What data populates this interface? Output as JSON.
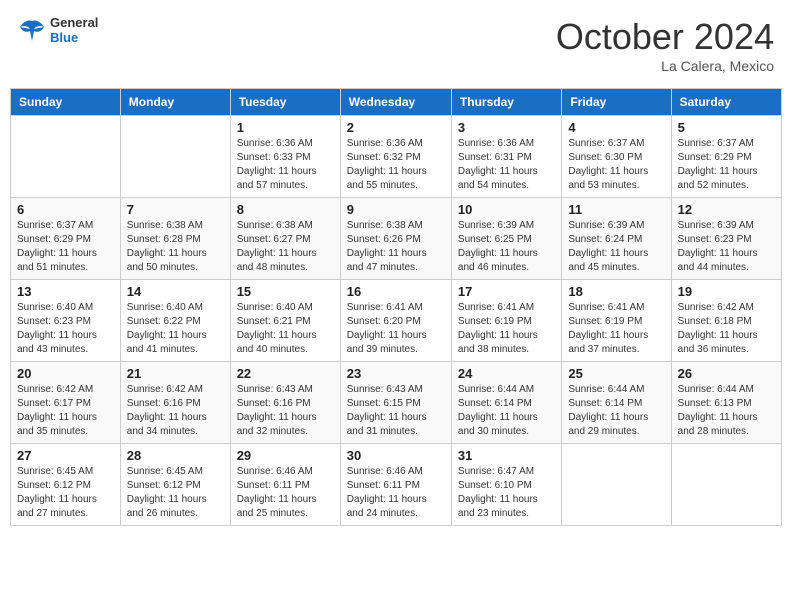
{
  "header": {
    "logo_line1": "General",
    "logo_line2": "Blue",
    "month_title": "October 2024",
    "subtitle": "La Calera, Mexico"
  },
  "weekdays": [
    "Sunday",
    "Monday",
    "Tuesday",
    "Wednesday",
    "Thursday",
    "Friday",
    "Saturday"
  ],
  "weeks": [
    [
      {
        "day": "",
        "info": ""
      },
      {
        "day": "",
        "info": ""
      },
      {
        "day": "1",
        "info": "Sunrise: 6:36 AM\nSunset: 6:33 PM\nDaylight: 11 hours and 57 minutes."
      },
      {
        "day": "2",
        "info": "Sunrise: 6:36 AM\nSunset: 6:32 PM\nDaylight: 11 hours and 55 minutes."
      },
      {
        "day": "3",
        "info": "Sunrise: 6:36 AM\nSunset: 6:31 PM\nDaylight: 11 hours and 54 minutes."
      },
      {
        "day": "4",
        "info": "Sunrise: 6:37 AM\nSunset: 6:30 PM\nDaylight: 11 hours and 53 minutes."
      },
      {
        "day": "5",
        "info": "Sunrise: 6:37 AM\nSunset: 6:29 PM\nDaylight: 11 hours and 52 minutes."
      }
    ],
    [
      {
        "day": "6",
        "info": "Sunrise: 6:37 AM\nSunset: 6:29 PM\nDaylight: 11 hours and 51 minutes."
      },
      {
        "day": "7",
        "info": "Sunrise: 6:38 AM\nSunset: 6:28 PM\nDaylight: 11 hours and 50 minutes."
      },
      {
        "day": "8",
        "info": "Sunrise: 6:38 AM\nSunset: 6:27 PM\nDaylight: 11 hours and 48 minutes."
      },
      {
        "day": "9",
        "info": "Sunrise: 6:38 AM\nSunset: 6:26 PM\nDaylight: 11 hours and 47 minutes."
      },
      {
        "day": "10",
        "info": "Sunrise: 6:39 AM\nSunset: 6:25 PM\nDaylight: 11 hours and 46 minutes."
      },
      {
        "day": "11",
        "info": "Sunrise: 6:39 AM\nSunset: 6:24 PM\nDaylight: 11 hours and 45 minutes."
      },
      {
        "day": "12",
        "info": "Sunrise: 6:39 AM\nSunset: 6:23 PM\nDaylight: 11 hours and 44 minutes."
      }
    ],
    [
      {
        "day": "13",
        "info": "Sunrise: 6:40 AM\nSunset: 6:23 PM\nDaylight: 11 hours and 43 minutes."
      },
      {
        "day": "14",
        "info": "Sunrise: 6:40 AM\nSunset: 6:22 PM\nDaylight: 11 hours and 41 minutes."
      },
      {
        "day": "15",
        "info": "Sunrise: 6:40 AM\nSunset: 6:21 PM\nDaylight: 11 hours and 40 minutes."
      },
      {
        "day": "16",
        "info": "Sunrise: 6:41 AM\nSunset: 6:20 PM\nDaylight: 11 hours and 39 minutes."
      },
      {
        "day": "17",
        "info": "Sunrise: 6:41 AM\nSunset: 6:19 PM\nDaylight: 11 hours and 38 minutes."
      },
      {
        "day": "18",
        "info": "Sunrise: 6:41 AM\nSunset: 6:19 PM\nDaylight: 11 hours and 37 minutes."
      },
      {
        "day": "19",
        "info": "Sunrise: 6:42 AM\nSunset: 6:18 PM\nDaylight: 11 hours and 36 minutes."
      }
    ],
    [
      {
        "day": "20",
        "info": "Sunrise: 6:42 AM\nSunset: 6:17 PM\nDaylight: 11 hours and 35 minutes."
      },
      {
        "day": "21",
        "info": "Sunrise: 6:42 AM\nSunset: 6:16 PM\nDaylight: 11 hours and 34 minutes."
      },
      {
        "day": "22",
        "info": "Sunrise: 6:43 AM\nSunset: 6:16 PM\nDaylight: 11 hours and 32 minutes."
      },
      {
        "day": "23",
        "info": "Sunrise: 6:43 AM\nSunset: 6:15 PM\nDaylight: 11 hours and 31 minutes."
      },
      {
        "day": "24",
        "info": "Sunrise: 6:44 AM\nSunset: 6:14 PM\nDaylight: 11 hours and 30 minutes."
      },
      {
        "day": "25",
        "info": "Sunrise: 6:44 AM\nSunset: 6:14 PM\nDaylight: 11 hours and 29 minutes."
      },
      {
        "day": "26",
        "info": "Sunrise: 6:44 AM\nSunset: 6:13 PM\nDaylight: 11 hours and 28 minutes."
      }
    ],
    [
      {
        "day": "27",
        "info": "Sunrise: 6:45 AM\nSunset: 6:12 PM\nDaylight: 11 hours and 27 minutes."
      },
      {
        "day": "28",
        "info": "Sunrise: 6:45 AM\nSunset: 6:12 PM\nDaylight: 11 hours and 26 minutes."
      },
      {
        "day": "29",
        "info": "Sunrise: 6:46 AM\nSunset: 6:11 PM\nDaylight: 11 hours and 25 minutes."
      },
      {
        "day": "30",
        "info": "Sunrise: 6:46 AM\nSunset: 6:11 PM\nDaylight: 11 hours and 24 minutes."
      },
      {
        "day": "31",
        "info": "Sunrise: 6:47 AM\nSunset: 6:10 PM\nDaylight: 11 hours and 23 minutes."
      },
      {
        "day": "",
        "info": ""
      },
      {
        "day": "",
        "info": ""
      }
    ]
  ]
}
